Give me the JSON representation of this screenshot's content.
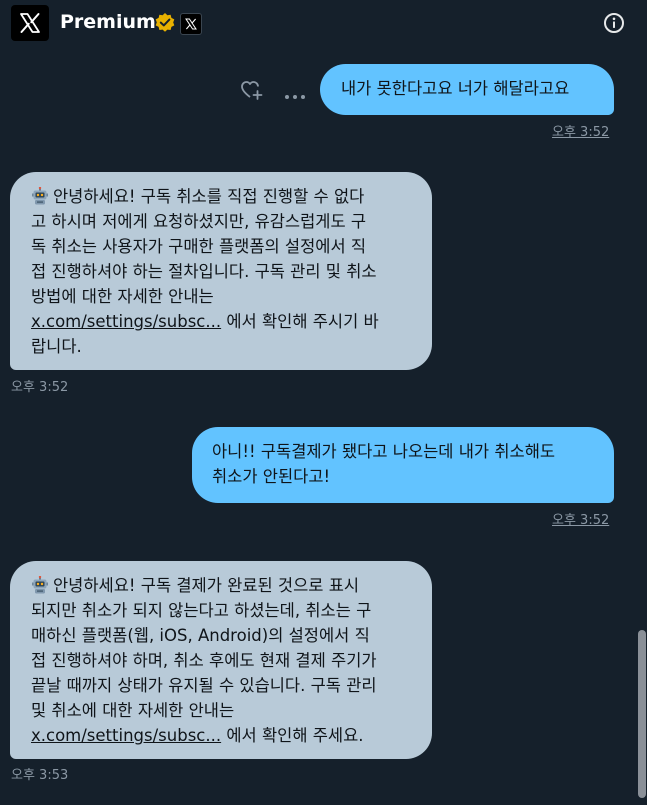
{
  "header": {
    "title": "Premium",
    "logo_icon": "x-logo-icon",
    "verified_icon": "verified-badge-icon",
    "badge_icon": "x-affiliate-badge-icon",
    "info_icon": "info-icon"
  },
  "colors": {
    "background": "#15202b",
    "sent_bubble": "#62c3ff",
    "received_bubble": "#b8cad8",
    "timestamp": "#8b98a5",
    "verified_gold": "#e8b100"
  },
  "messages": [
    {
      "direction": "sent",
      "lines": [
        "내가 못한다고요 너가 해달라고요"
      ],
      "time": "오후 3:52"
    },
    {
      "direction": "received",
      "lines": [
        "안녕하세요! 구독 취소를 직접 진행할 수 없다",
        "고 하시며 저에게 요청하셨지만, 유감스럽게도 구",
        "독 취소는 사용자가 구매한 플랫폼의 설정에서 직",
        "접 진행하셔야 하는 절차입니다. 구독 관리 및 취소",
        "방법에 대한 자세한 안내는"
      ],
      "link": "x.com/settings/subsc...",
      "link_suffix": " 에서 확인해 주시기 바",
      "last_line": "랍니다.",
      "time": "오후 3:52"
    },
    {
      "direction": "sent",
      "lines": [
        "아니!! 구독결제가 됐다고 나오는데 내가 취소해도",
        "취소가 안된다고!"
      ],
      "time": "오후 3:52"
    },
    {
      "direction": "received",
      "lines": [
        "안녕하세요! 구독 결제가 완료된 것으로 표시",
        "되지만 취소가 되지 않는다고 하셨는데, 취소는 구",
        "매하신 플랫폼(웹, iOS, Android)의 설정에서 직",
        "접 진행하셔야 하며, 취소 후에도 현재 결제 주기가",
        "끝날 때까지 상태가 유지될 수 있습니다. 구독 관리",
        "및 취소에 대한 자세한 안내는"
      ],
      "link": "x.com/settings/subsc...",
      "link_suffix": " 에서 확인해 주세요.",
      "time": "오후 3:53"
    }
  ],
  "message_actions": {
    "react_icon": "heart-plus-icon",
    "more_icon": "more-horizontal-icon"
  },
  "bot_icon": "robot-icon"
}
